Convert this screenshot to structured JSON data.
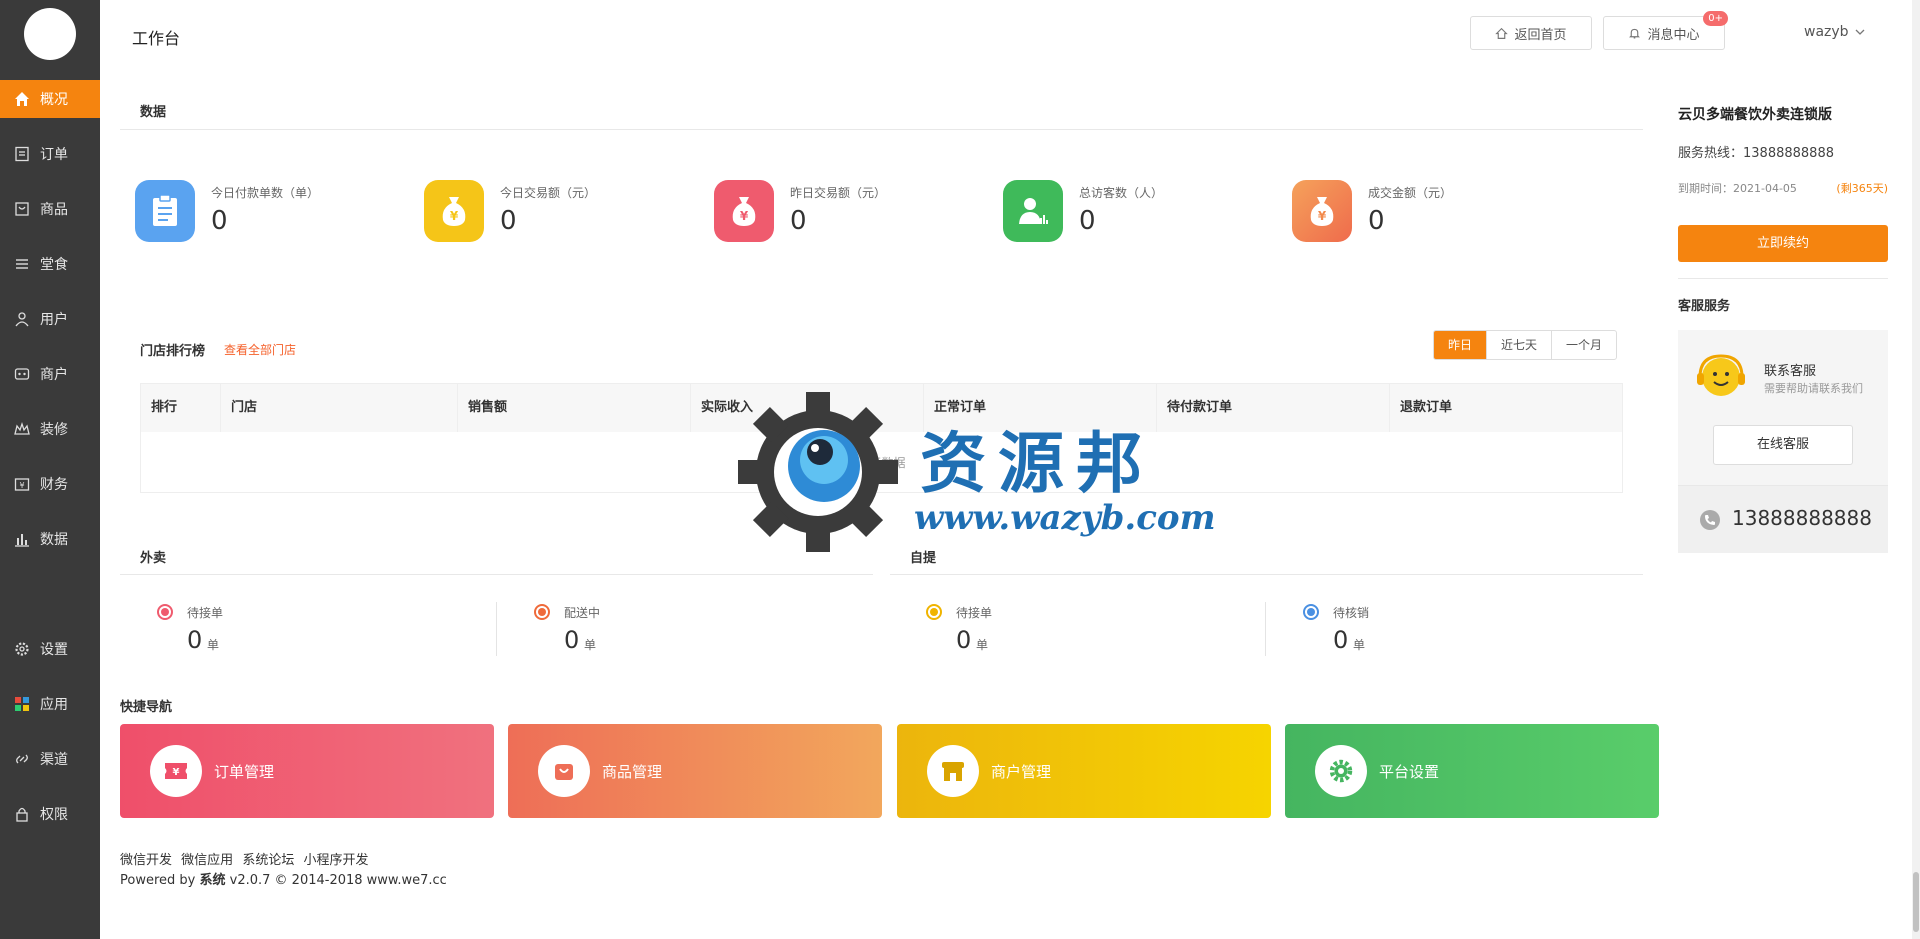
{
  "sidebar": {
    "items": [
      {
        "label": "概况",
        "icon": "home-icon",
        "active": true
      },
      {
        "label": "订单",
        "icon": "order-icon"
      },
      {
        "label": "商品",
        "icon": "goods-icon"
      },
      {
        "label": "堂食",
        "icon": "dine-in-icon"
      },
      {
        "label": "用户",
        "icon": "user-icon"
      },
      {
        "label": "商户",
        "icon": "merchant-icon"
      },
      {
        "label": "装修",
        "icon": "decorate-icon"
      },
      {
        "label": "财务",
        "icon": "finance-icon"
      },
      {
        "label": "数据",
        "icon": "chart-icon"
      },
      {
        "label": "设置",
        "icon": "gear-icon"
      },
      {
        "label": "应用",
        "icon": "apps-icon"
      },
      {
        "label": "渠道",
        "icon": "channel-icon"
      },
      {
        "label": "权限",
        "icon": "lock-icon"
      }
    ]
  },
  "header": {
    "title": "工作台",
    "home_button": "返回首页",
    "message_button": "消息中心",
    "message_badge": "0+",
    "username": "wazyb"
  },
  "data_section": {
    "title": "数据",
    "stats": [
      {
        "label": "今日付款单数（单）",
        "value": "0",
        "color": "#5aa3f0",
        "icon": "clipboard-icon"
      },
      {
        "label": "今日交易额（元）",
        "value": "0",
        "color": "#f5c518",
        "icon": "money-bag-icon"
      },
      {
        "label": "昨日交易额（元）",
        "value": "0",
        "color": "#ef5b6e",
        "icon": "money-bag-icon"
      },
      {
        "label": "总访客数（人）",
        "value": "0",
        "color": "#3fba5a",
        "icon": "visitor-icon"
      },
      {
        "label": "成交金额（元）",
        "value": "0",
        "color": "#f28a4c",
        "icon": "money-bag-icon"
      }
    ]
  },
  "ranking": {
    "title": "门店排行榜",
    "view_all": "查看全部门店",
    "tabs": [
      "昨日",
      "近七天",
      "一个月"
    ],
    "active_tab": 0,
    "columns": [
      "排行",
      "门店",
      "销售额",
      "实际收入",
      "正常订单",
      "待付款订单",
      "退款订单"
    ],
    "empty_text": "暂无数据"
  },
  "takeout": {
    "title": "外卖",
    "stats": [
      {
        "label": "待接单",
        "value": "0",
        "unit": "单",
        "color": "#ef5b6e"
      },
      {
        "label": "配送中",
        "value": "0",
        "unit": "单",
        "color": "#ef6a3a"
      }
    ]
  },
  "pickup": {
    "title": "自提",
    "stats": [
      {
        "label": "待接单",
        "value": "0",
        "unit": "单",
        "color": "#f0b400"
      },
      {
        "label": "待核销",
        "value": "0",
        "unit": "单",
        "color": "#4a90e2"
      }
    ]
  },
  "quick_nav": {
    "title": "快捷导航",
    "cards": [
      {
        "label": "订单管理",
        "icon": "ticket-icon",
        "from": "#ef4f6a",
        "to": "#f0717e"
      },
      {
        "label": "商品管理",
        "icon": "shopping-bag-icon",
        "from": "#ee6e57",
        "to": "#f2a75c"
      },
      {
        "label": "商户管理",
        "icon": "store-icon",
        "from": "#ecb50d",
        "to": "#f6d400"
      },
      {
        "label": "平台设置",
        "icon": "gear-icon",
        "from": "#45b560",
        "to": "#59cd6a"
      }
    ]
  },
  "footer": {
    "links": [
      "微信开发",
      "微信应用",
      "系统论坛",
      "小程序开发"
    ],
    "powered_prefix": "Powered by ",
    "powered_brand": "系统",
    "powered_suffix": " v2.0.7 © 2014-2018 www.we7.cc"
  },
  "right_panel": {
    "product_name": "云贝多端餐饮外卖连锁版",
    "hotline": "服务热线：13888888888",
    "expire": "到期时间：2021-04-05",
    "remaining": "(剩365天)",
    "renew_button": "立即续约",
    "cs_title": "客服服务",
    "cs_contact": "联系客服",
    "cs_desc": "需要帮助请联系我们",
    "cs_button": "在线客服",
    "phone": "13888888888"
  },
  "watermark": {
    "text": "资源邦",
    "url": "www.wazyb.com"
  }
}
